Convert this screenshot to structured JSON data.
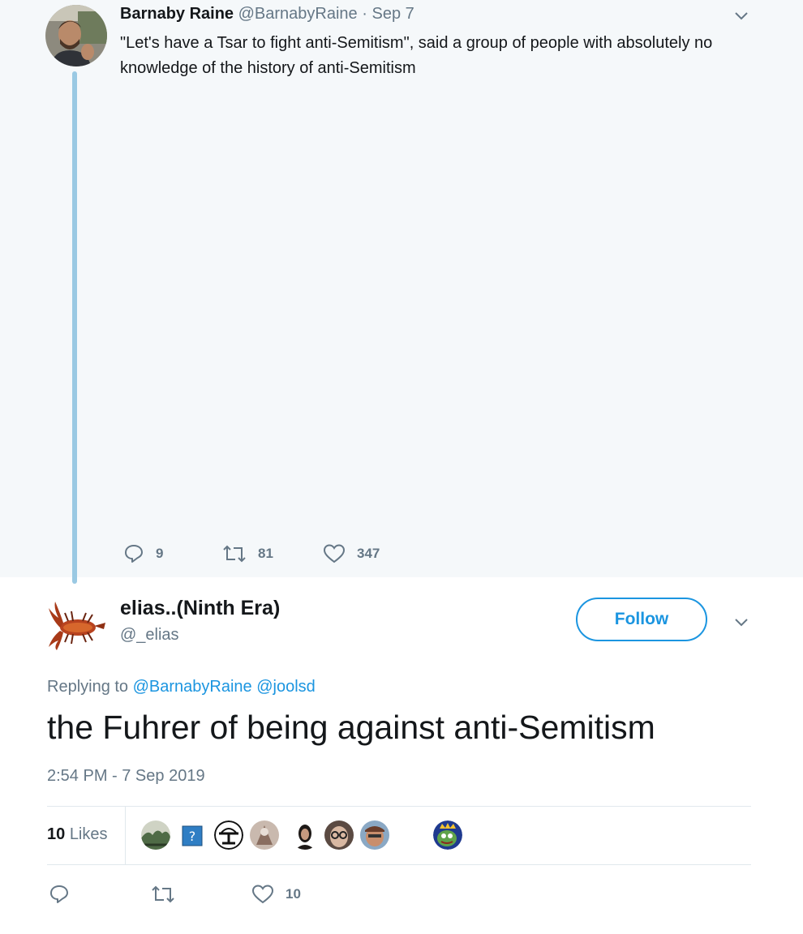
{
  "parent_tweet": {
    "author_name": "Barnaby Raine",
    "author_handle": "@BarnabyRaine",
    "separator": "·",
    "date": "Sep 7",
    "text": "\"Let's have a Tsar to fight anti-Semitism\", said a group of people with absolutely no knowledge of the history of anti-Semitism",
    "replies": "9",
    "retweets": "81",
    "likes": "347"
  },
  "reply_tweet": {
    "author_name": "elias..(Ninth Era)",
    "author_handle": "@_elias",
    "follow_label": "Follow",
    "replying_prefix": "Replying to",
    "replying_mentions": [
      "@BarnabyRaine",
      "@joolsd"
    ],
    "text": "the Fuhrer of being against anti-Semitism",
    "timestamp": "2:54 PM - 7 Sep 2019",
    "likes_count": "10",
    "likes_word": "Likes",
    "action_likes": "10"
  },
  "colors": {
    "accent": "#1b95e0",
    "secondary_text": "#657786",
    "thread_line": "#9ac9e3",
    "parent_bg": "#f5f8fa"
  },
  "icons": [
    "chevron-down-icon",
    "reply-icon",
    "retweet-icon",
    "heart-icon",
    "help-icon"
  ]
}
